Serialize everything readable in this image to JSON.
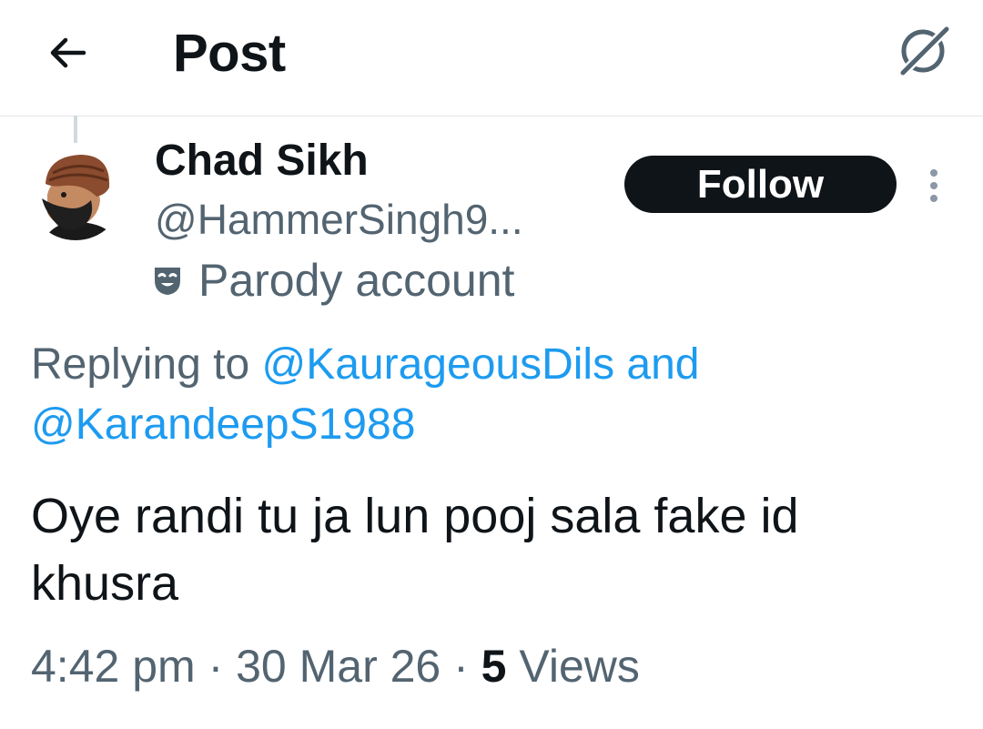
{
  "header": {
    "title": "Post",
    "back_icon": "back-arrow-icon",
    "grok_icon": "grok-icon"
  },
  "author": {
    "name": "Chad Sikh",
    "handle": "@HammerSingh9...",
    "label": "Parody account",
    "label_icon": "theater-mask-icon",
    "follow_label": "Follow"
  },
  "reply": {
    "prefix": "Replying to ",
    "mention_1": "@KaurageousDils",
    "conjunction": " and",
    "mention_2": "@KarandeepS1988"
  },
  "post": {
    "text": "Oye randi tu ja lun pooj sala fake id khusra",
    "time": "4:42 pm",
    "separator": " · ",
    "date": "30 Mar 26",
    "views_count": "5",
    "views_label": "Views"
  },
  "colors": {
    "link": "#1d9bf0",
    "muted": "#536471",
    "text": "#0f1419",
    "button": "#0f1419"
  }
}
